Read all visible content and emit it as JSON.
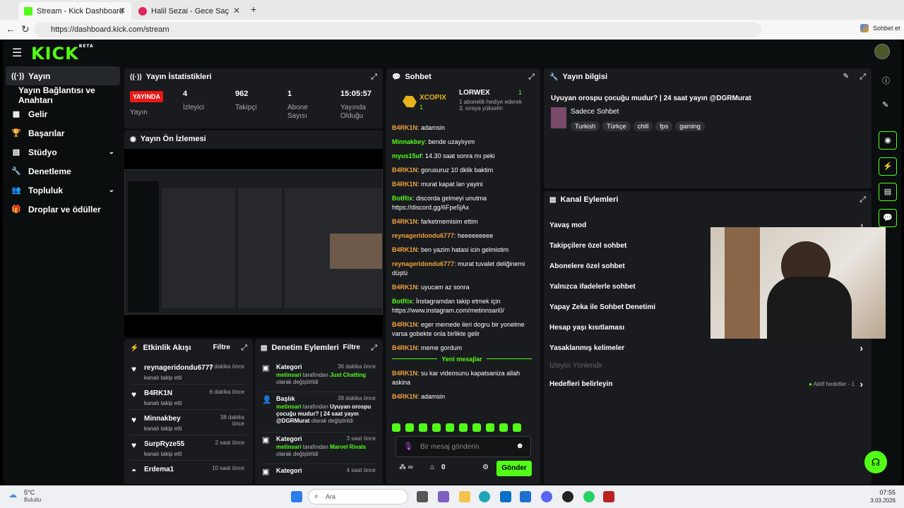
{
  "browser": {
    "tab1": "Stream - Kick Dashboard",
    "tab2": "Halil Sezai - Gece Saçlım (Can",
    "url": "https://dashboard.kick.com/stream",
    "profile_btn": "Sohbet et"
  },
  "logo": {
    "text": "KICK",
    "beta": "BETA"
  },
  "sidebar": [
    {
      "label": "Yayın",
      "icon": "broadcast-icon"
    },
    {
      "label": "Yayın Bağlantısı ve Anahtarı",
      "icon": ""
    },
    {
      "label": "Gelir",
      "icon": "revenue-icon"
    },
    {
      "label": "Başarılar",
      "icon": "trophy-icon"
    },
    {
      "label": "Stüdyo",
      "icon": "studio-icon"
    },
    {
      "label": "Denetleme",
      "icon": "wrench-icon"
    },
    {
      "label": "Topluluk",
      "icon": "community-icon"
    },
    {
      "label": "Droplar ve ödüller",
      "icon": "gift-icon"
    }
  ],
  "stats": {
    "title": "Yayın İstatistikleri",
    "live": "YAYINDA",
    "live_label": "Yayın",
    "viewers": "4",
    "viewers_label": "İzleyici",
    "followers": "962",
    "followers_label": "Takipçi",
    "subs": "1",
    "subs_label": "Abone Sayısı",
    "uptime": "15:05:57",
    "uptime_label": "Yayında Olduğu"
  },
  "preview": {
    "title": "Yayın Ön İzlemesi"
  },
  "activity": {
    "title": "Etkinlik Akışı",
    "filter": "Filtre",
    "items": [
      {
        "name": "reynageridondu6777",
        "sub": "kanalı takip etti",
        "time": "6 dakika önce"
      },
      {
        "name": "B4RK1N",
        "sub": "kanalı takip etti",
        "time": "6 dakika önce"
      },
      {
        "name": "Minnakbey",
        "sub": "kanalı takip etti",
        "time": "38 dakika önce"
      },
      {
        "name": "SurpRyze55",
        "sub": "kanalı takip etti",
        "time": "2 saat önce"
      },
      {
        "name": "Erdema1",
        "sub": "",
        "time": "10 saat önce"
      }
    ]
  },
  "modlog": {
    "title": "Denetim Eylemleri",
    "filter": "Filtre",
    "items": [
      {
        "title": "Kategori",
        "time": "36 dakika önce",
        "user": "metinsari",
        "mid": " tarafından ",
        "val": "Just Chatting",
        "end": " olarak değiştirildi"
      },
      {
        "title": "Başlık",
        "time": "39 dakika önce",
        "user": "metinsari",
        "mid": " tarafından ",
        "val": "Uyuyan orospu çocuğu mudur? | 24 saat yayın @DGRMurat",
        "end": " olarak değiştirildi"
      },
      {
        "title": "Kategori",
        "time": "3 saat önce",
        "user": "metinsari",
        "mid": " tarafından ",
        "val": "Marvel Rivals",
        "end": " olarak değiştirildi"
      },
      {
        "title": "Kategori",
        "time": "4 saat önce",
        "user": "",
        "mid": "",
        "val": "",
        "end": ""
      }
    ]
  },
  "chat": {
    "title": "Sohbet",
    "gifter1": "XCOPIX",
    "gifter1_count": "1",
    "gifter2": "LORWEX",
    "gifter2_count": "1",
    "gifter2_text": "1 abonelik hediye ederek 3. sıraya yükselin",
    "messages": [
      {
        "user": "B4RK1N",
        "color": "#f2a33a",
        "text": "adamsin"
      },
      {
        "user": "Minnakbey",
        "color": "#53fc18",
        "text": "bende uzaylıyım"
      },
      {
        "user": "myus15uf",
        "color": "#53fc18",
        "text": "14.30 saat sonra mı peki"
      },
      {
        "user": "B4RK1N",
        "color": "#f2a33a",
        "text": "gorusuruz 10 dklik baktim"
      },
      {
        "user": "B4RK1N",
        "color": "#f2a33a",
        "text": "murat kapat lan yayini"
      },
      {
        "user": "BotRix",
        "color": "#53fc18",
        "text": "discorda gelmeyi unutma https://discord.gg/6Fpe5jAx"
      },
      {
        "user": "B4RK1N",
        "color": "#f2a33a",
        "text": "farketmemisim ettim"
      },
      {
        "user": "reynageridondu6777",
        "color": "#f2a33a",
        "text": "heeeeeeeee"
      },
      {
        "user": "B4RK1N",
        "color": "#f2a33a",
        "text": "ben yazim hatasi icin gelmistim"
      },
      {
        "user": "reynageridondu6777",
        "color": "#f2a33a",
        "text": "murat tuvalet deliğinemi düştü"
      },
      {
        "user": "B4RK1N",
        "color": "#f2a33a",
        "text": "uyucam az sonra"
      },
      {
        "user": "BotRix",
        "color": "#53fc18",
        "text": "İnstagramdan takip etmek için https://www.instagram.com/metinnsari0/"
      },
      {
        "user": "B4RK1N",
        "color": "#f2a33a",
        "text": "eger memede ileri dogru bir yonelme varsa gobekte onla birlikte gelir"
      },
      {
        "user": "B4RK1N",
        "color": "#f2a33a",
        "text": "meme gordum"
      }
    ],
    "new_messages": "Yeni mesajlar",
    "after": [
      {
        "user": "B4RK1N",
        "color": "#f2a33a",
        "text": "su kar videosunu kapatsaniza allah askina"
      },
      {
        "user": "B4RK1N",
        "color": "#f2a33a",
        "text": "adamsin"
      }
    ],
    "placeholder": "Bir mesaj gönderin",
    "points": "0",
    "send": "Gönder"
  },
  "info": {
    "title": "Yayın bilgisi",
    "stream_title": "Uyuyan orospu çocuğu mudur? | 24 saat yayın @DGRMurat",
    "category": "Sadece Sohbet",
    "tags": [
      "Turkish",
      "Türkçe",
      "chill",
      "fps",
      "gaming"
    ]
  },
  "channel": {
    "title": "Kanal Eylemleri",
    "items": [
      "Yavaş mod",
      "Takipçilere özel sohbet",
      "Abonelere özel sohbet",
      "Yalnızca ifadelerle sohbet",
      "Yapay Zeka ile Sohbet Denetimi",
      "Hesap yaşı kısıtlaması",
      "Yasaklanmış kelimeler"
    ],
    "section": "İzleyici Yönlendir",
    "goals": "Hedefleri belirleyin",
    "goals_status": "Aktif hedefler - 1"
  },
  "taskbar": {
    "weather": "5°C",
    "weather_sub": "Bulutlu",
    "search": "Ara",
    "time": "07:55",
    "date": "3.03.2026"
  }
}
